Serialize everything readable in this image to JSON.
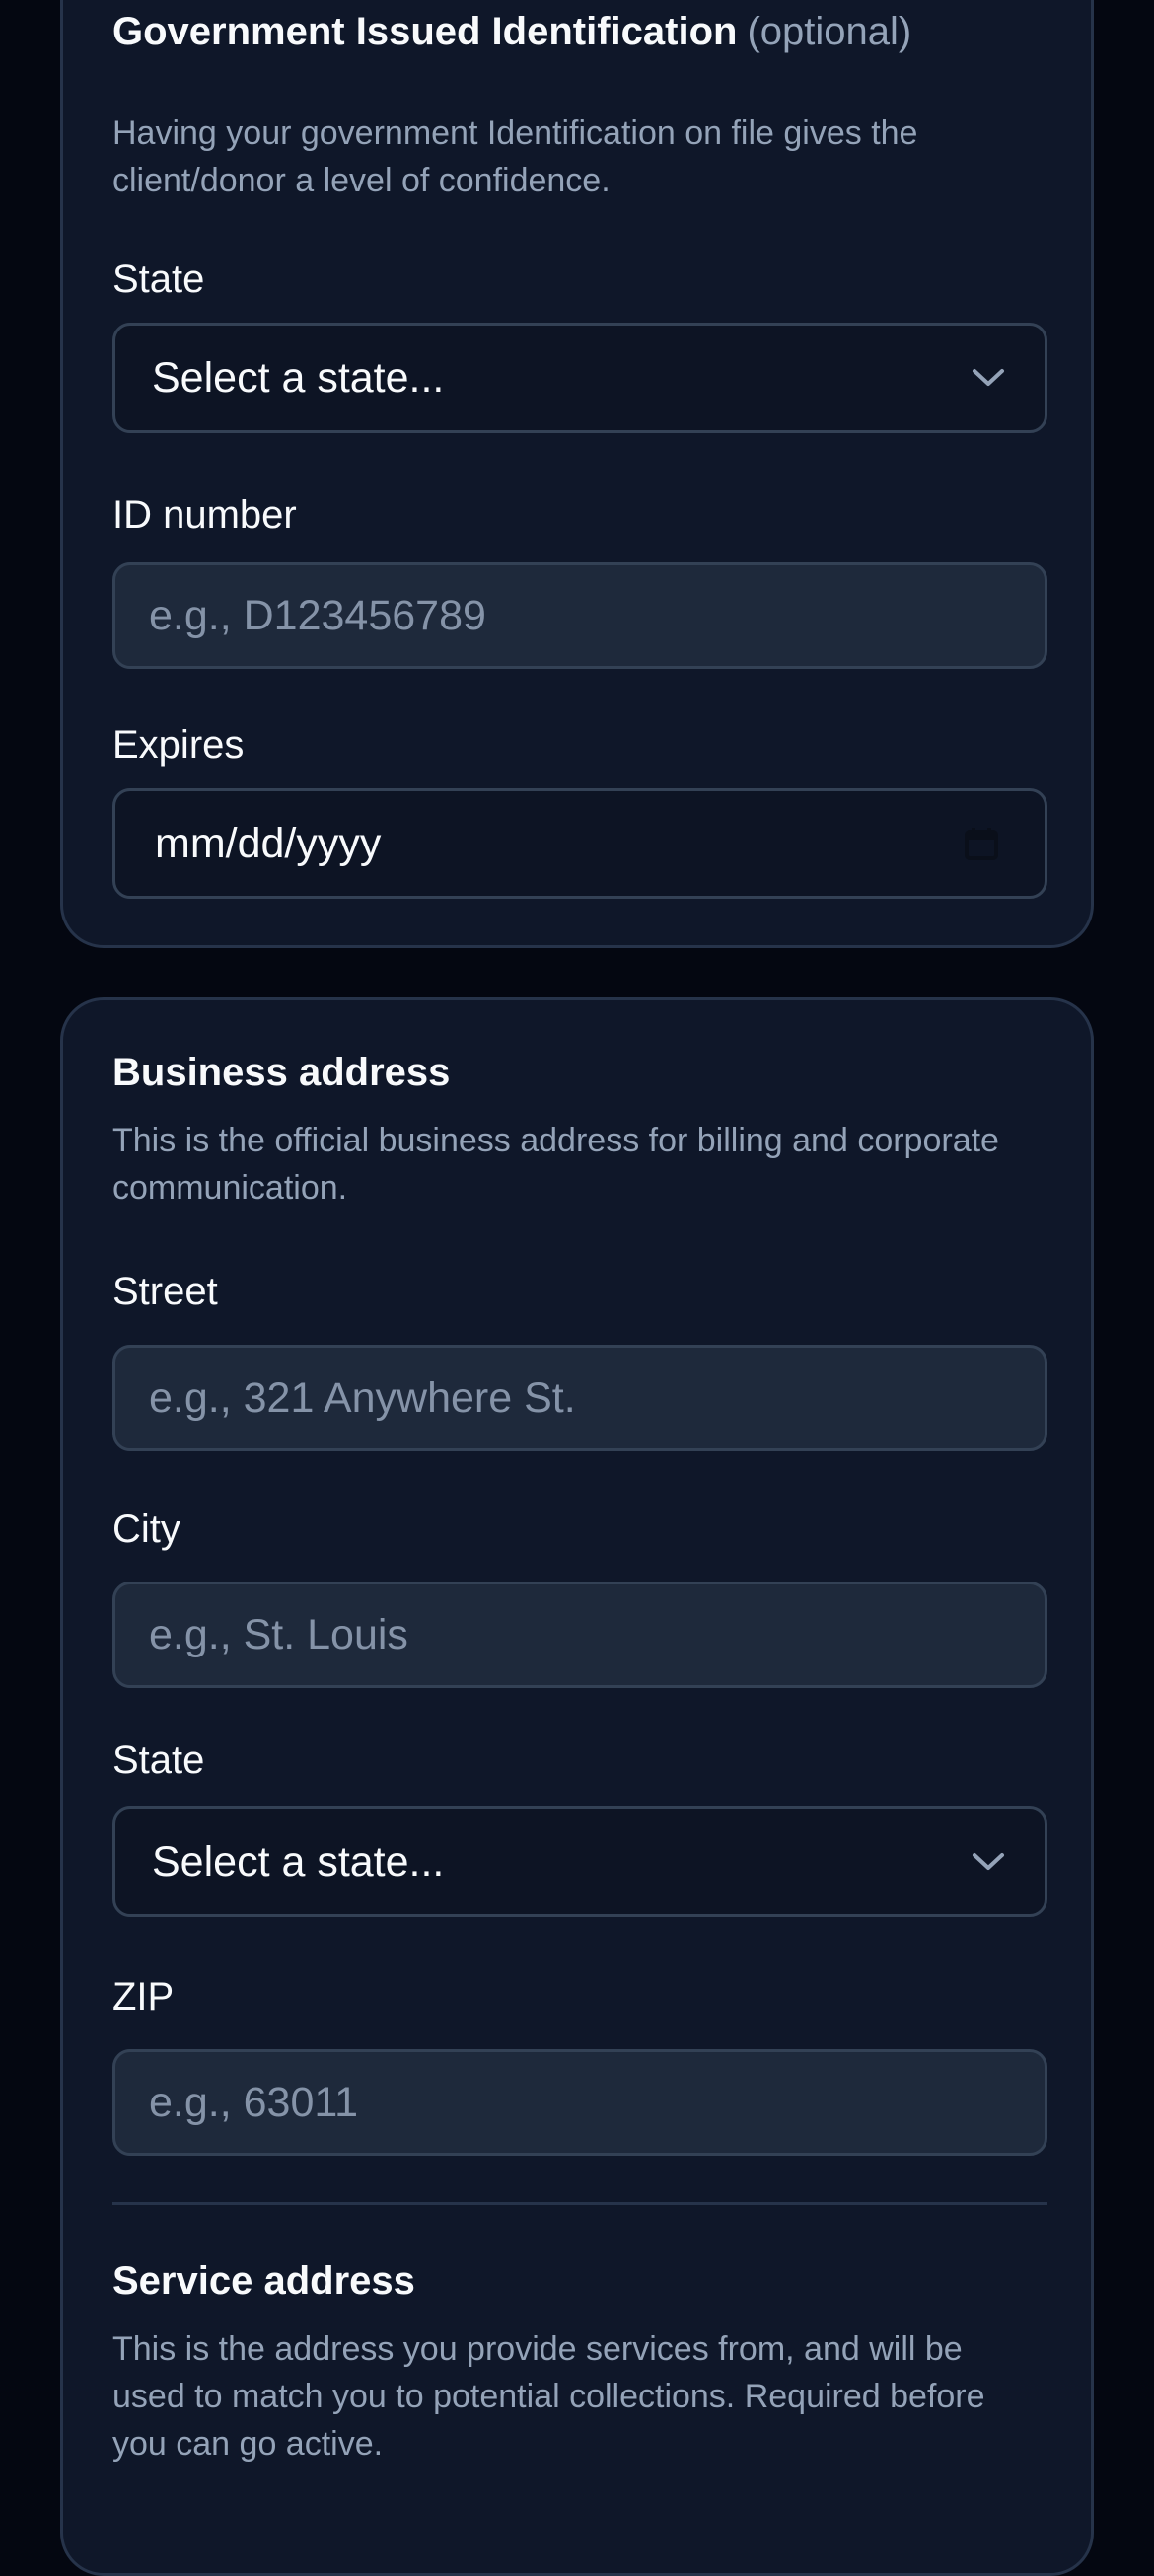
{
  "gov_id": {
    "title": "Government Issued Identification",
    "optional": "(optional)",
    "description": "Having your government Identification on file gives the client/donor a level of confidence.",
    "state_label": "State",
    "state_value": "Select a state...",
    "id_label": "ID number",
    "id_placeholder": "e.g., D123456789",
    "expires_label": "Expires",
    "expires_value": "mm/dd/yyyy"
  },
  "business": {
    "title": "Business address",
    "description": "This is the official business address for billing and corporate communication.",
    "street_label": "Street",
    "street_placeholder": "e.g., 321 Anywhere St.",
    "city_label": "City",
    "city_placeholder": "e.g., St. Louis",
    "state_label": "State",
    "state_value": "Select a state...",
    "zip_label": "ZIP",
    "zip_placeholder": "e.g., 63011"
  },
  "service": {
    "title": "Service address",
    "description": "This is the address you provide services from, and will be used to match you to potential collections. Required before you can go active."
  },
  "icons": {
    "chevron": "chevron-down-icon",
    "calendar": "calendar-icon"
  },
  "colors": {
    "page_bg": "#040711",
    "card_bg": "#0f1729",
    "input_bg": "#1e293b",
    "border": "#334155",
    "muted_text": "#94a3b8"
  }
}
